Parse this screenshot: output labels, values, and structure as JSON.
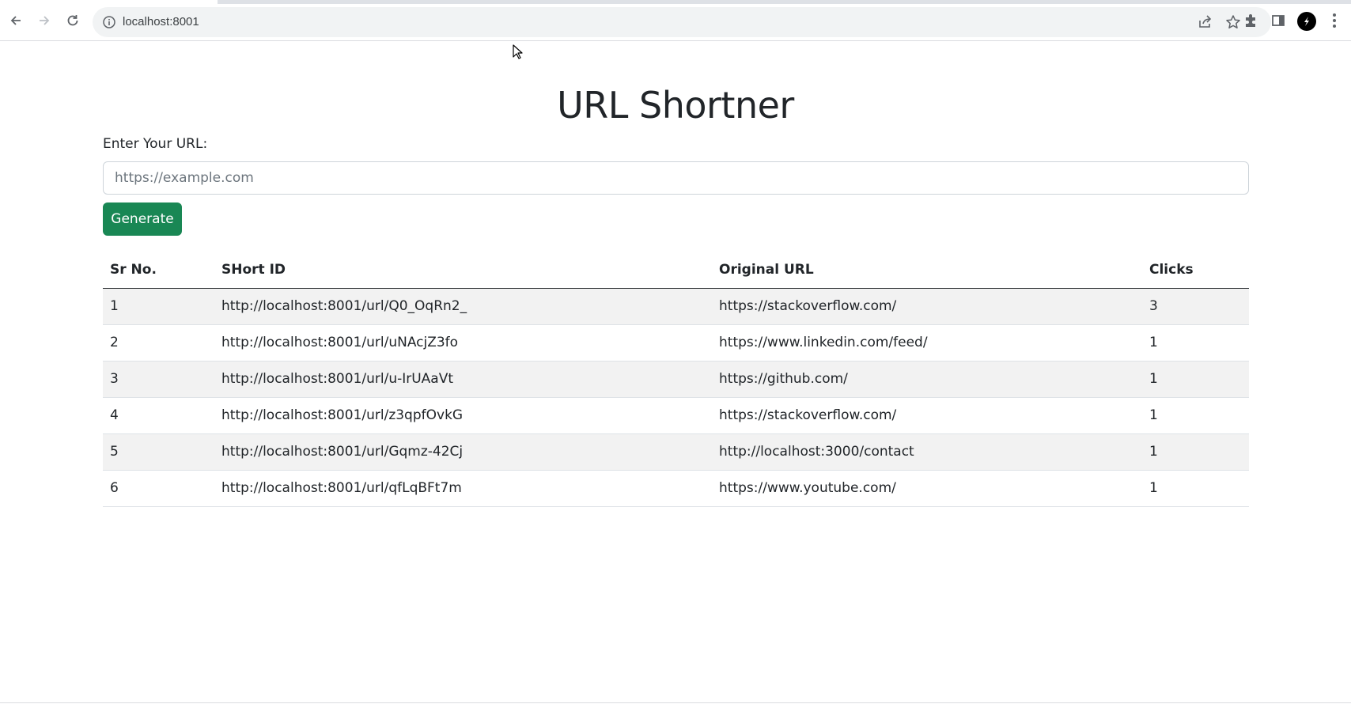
{
  "browser": {
    "url": "localhost:8001"
  },
  "page": {
    "title": "URL Shortner",
    "input_label": "Enter Your URL:",
    "input_placeholder": "https://example.com",
    "input_value": "",
    "generate_label": "Generate"
  },
  "table": {
    "headers": {
      "sr": "Sr No.",
      "short_id": "SHort ID",
      "original_url": "Original URL",
      "clicks": "Clicks"
    },
    "rows": [
      {
        "sr": "1",
        "short_id": "http://localhost:8001/url/Q0_OqRn2_",
        "original_url": "https://stackoverflow.com/",
        "clicks": "3"
      },
      {
        "sr": "2",
        "short_id": "http://localhost:8001/url/uNAcjZ3fo",
        "original_url": "https://www.linkedin.com/feed/",
        "clicks": "1"
      },
      {
        "sr": "3",
        "short_id": "http://localhost:8001/url/u-IrUAaVt",
        "original_url": "https://github.com/",
        "clicks": "1"
      },
      {
        "sr": "4",
        "short_id": "http://localhost:8001/url/z3qpfOvkG",
        "original_url": "https://stackoverflow.com/",
        "clicks": "1"
      },
      {
        "sr": "5",
        "short_id": "http://localhost:8001/url/Gqmz-42Cj",
        "original_url": "http://localhost:3000/contact",
        "clicks": "1"
      },
      {
        "sr": "6",
        "short_id": "http://localhost:8001/url/qfLqBFt7m",
        "original_url": "https://www.youtube.com/",
        "clicks": "1"
      }
    ]
  },
  "colors": {
    "button_green": "#198754",
    "stripe": "#f2f2f2",
    "text": "#212529"
  }
}
